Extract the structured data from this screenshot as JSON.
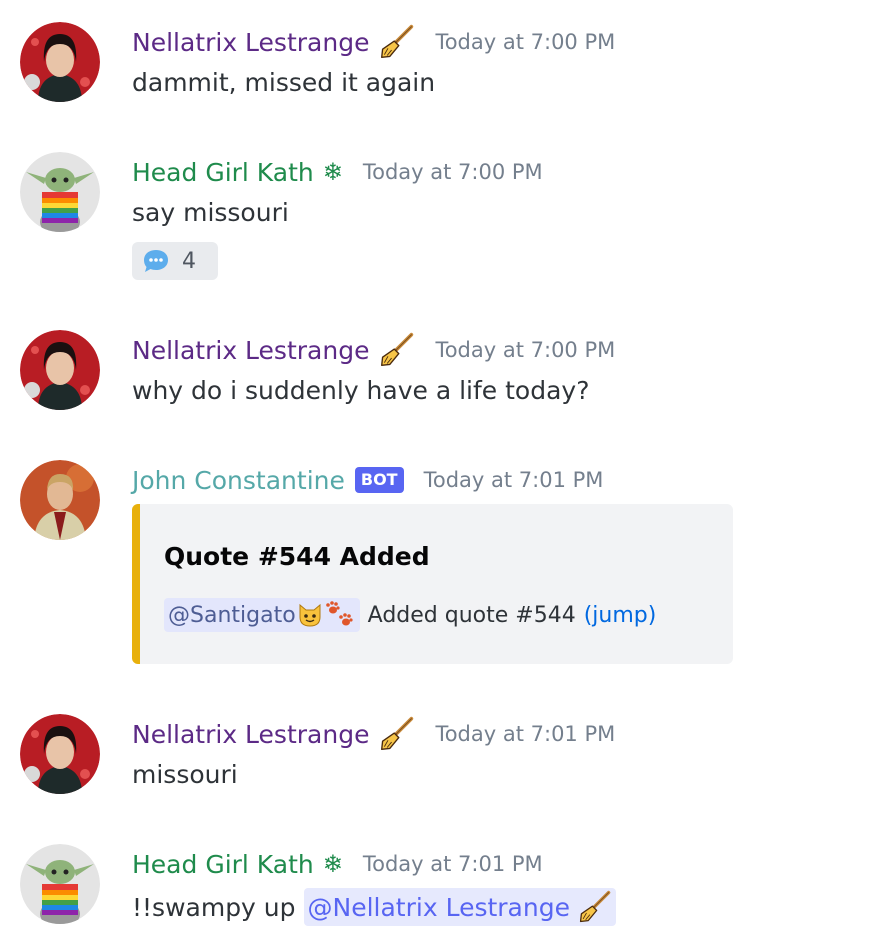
{
  "messages": [
    {
      "author": "Nellatrix Lestrange",
      "role_icon": "broom-icon",
      "timestamp": "Today at 7:00 PM",
      "text": "dammit, missed it again"
    },
    {
      "author": "Head Girl Kath",
      "role_icon": "snowflake-icon",
      "role_glyph": "❄",
      "timestamp": "Today at 7:00 PM",
      "text": "say missouri",
      "reaction": {
        "icon": "speech-bubble-icon",
        "count": "4"
      }
    },
    {
      "author": "Nellatrix Lestrange",
      "role_icon": "broom-icon",
      "timestamp": "Today at 7:00 PM",
      "text": "why do i suddenly have a life today?"
    },
    {
      "author": "John Constantine",
      "badge": "BOT",
      "timestamp": "Today at 7:01 PM",
      "embed": {
        "accent_color": "#e8b00c",
        "title": "Quote #544 Added",
        "mention": "@Santigato",
        "mention_icons": [
          "cat-face-icon",
          "paw-prints-icon"
        ],
        "description": "Added quote #544",
        "link": "(jump)"
      }
    },
    {
      "author": "Nellatrix Lestrange",
      "role_icon": "broom-icon",
      "timestamp": "Today at 7:01 PM",
      "text": "missouri"
    },
    {
      "author": "Head Girl Kath",
      "role_icon": "snowflake-icon",
      "role_glyph": "❄",
      "timestamp": "Today at 7:01 PM",
      "text": "!!swampy up",
      "mention": "@Nellatrix Lestrange",
      "mention_icon": "broom-icon"
    }
  ],
  "colors": {
    "nellatrix": "#5c2a86",
    "kath": "#1f8b4c",
    "john": "#55a8a8",
    "bot_badge": "#5865f2",
    "embed_accent": "#e8b00c"
  }
}
